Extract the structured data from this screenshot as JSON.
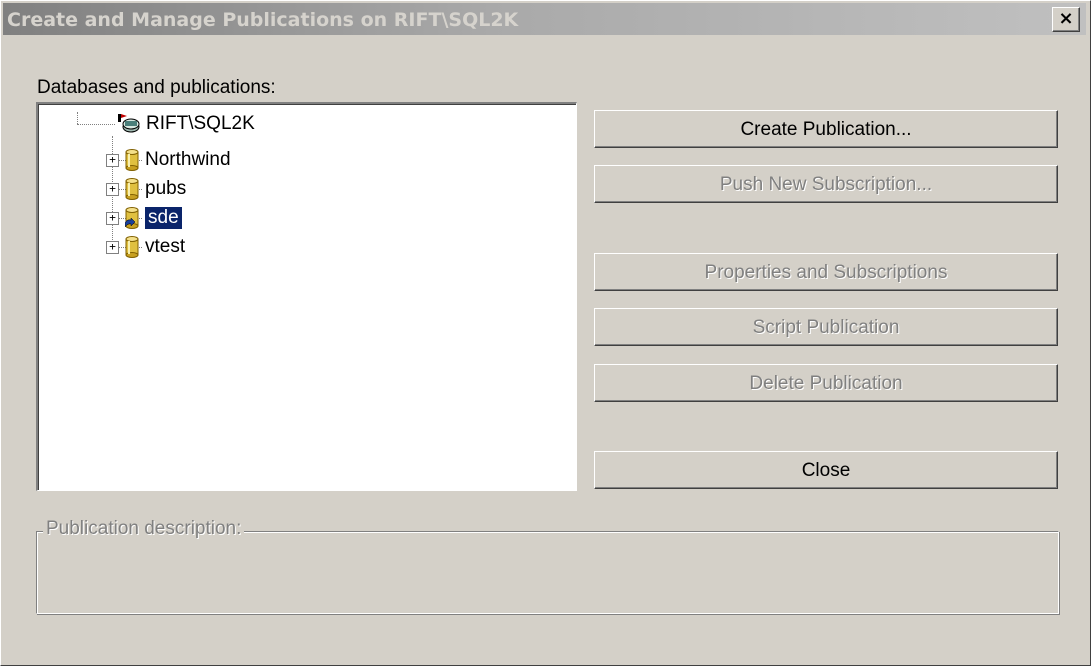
{
  "window": {
    "title": "Create and Manage Publications on RIFT\\SQL2K",
    "close_glyph": "×"
  },
  "labels": {
    "databases": "Databases and publications:",
    "group": "Publication description:"
  },
  "tree": {
    "root": {
      "label": "RIFT\\SQL2K",
      "icon": "server-icon"
    },
    "items": [
      {
        "label": "Northwind",
        "icon": "database-icon",
        "selected": false
      },
      {
        "label": "pubs",
        "icon": "database-icon",
        "selected": false
      },
      {
        "label": "sde",
        "icon": "published-database-icon",
        "selected": true
      },
      {
        "label": "vtest",
        "icon": "database-icon",
        "selected": false
      }
    ]
  },
  "buttons": {
    "create": "Create Publication...",
    "push": "Push New Subscription...",
    "properties": "Properties and Subscriptions",
    "script": "Script Publication",
    "delete": "Delete Publication",
    "close": "Close"
  },
  "colors": {
    "selection": "#0a246a",
    "disabled_text": "#808080",
    "face": "#d4d0c8"
  }
}
